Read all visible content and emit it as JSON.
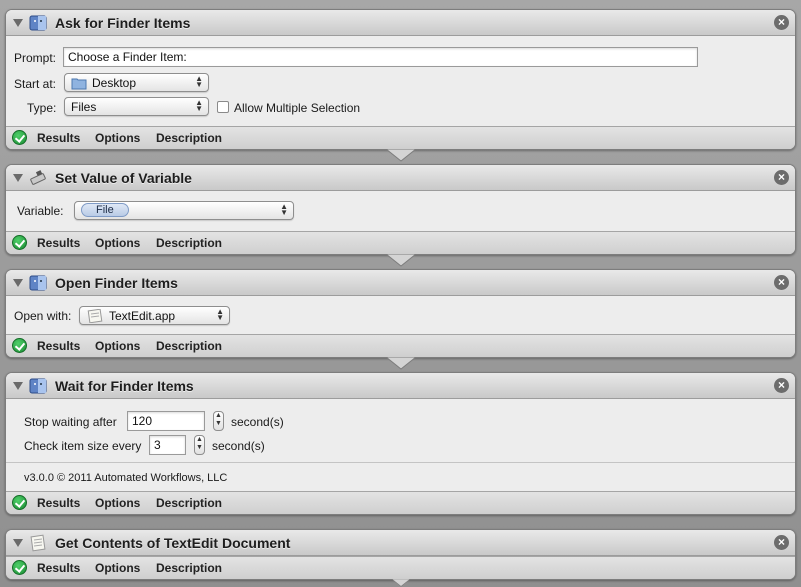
{
  "actions": [
    {
      "title": "Ask for Finder Items",
      "icon": "finder-icon",
      "prompt_label": "Prompt:",
      "prompt_value": "Choose a Finder Item:",
      "start_label": "Start at:",
      "start_value": "Desktop",
      "type_label": "Type:",
      "type_value": "Files",
      "allow_multiple_label": "Allow Multiple Selection"
    },
    {
      "title": "Set Value of Variable",
      "icon": "variable-icon",
      "variable_label": "Variable:",
      "variable_value": "File"
    },
    {
      "title": "Open Finder Items",
      "icon": "finder-icon",
      "open_with_label": "Open with:",
      "open_with_value": "TextEdit.app"
    },
    {
      "title": "Wait for Finder Items",
      "icon": "finder-icon",
      "stop_label": "Stop waiting after",
      "stop_value": "120",
      "stop_unit": "second(s)",
      "check_label": "Check item size every",
      "check_value": "3",
      "check_unit": "second(s)",
      "version": "v3.0.0 © 2011 Automated Workflows, LLC"
    },
    {
      "title": "Get Contents of TextEdit Document",
      "icon": "textedit-icon"
    }
  ],
  "footer": {
    "results": "Results",
    "options": "Options",
    "description": "Description"
  },
  "close_glyph": "×",
  "colors": {
    "status_ok": "#1a8b33",
    "token": "#b9cbe6"
  }
}
